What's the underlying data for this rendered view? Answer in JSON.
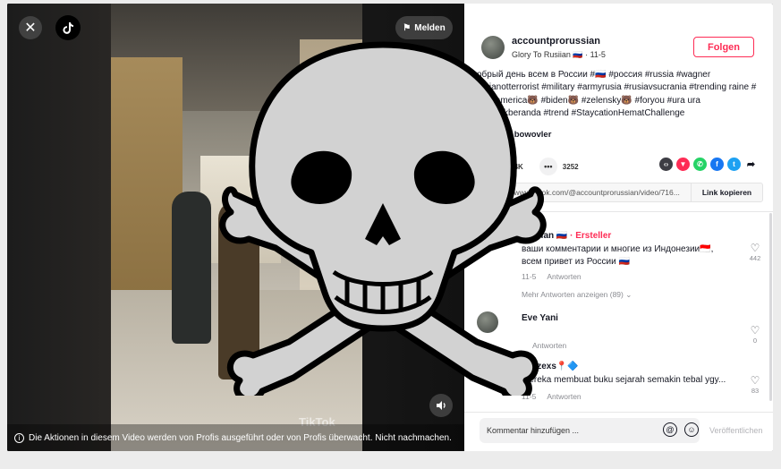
{
  "video": {
    "close_icon": "close-icon",
    "report_label": "Melden",
    "watermark": "TikTok",
    "warning": "Die Aktionen in diesem Video werden von Profis ausgeführt oder von Profis überwacht. Nicht nachmachen."
  },
  "post": {
    "username": "accountprorussian",
    "subline": "Glory To Rusiian 🇷🇺 · 11-5",
    "follow_label": "Folgen",
    "description": "обрый день всем в России #🇷🇺 #россия #russia #wagner rusianotterrorist #military #armyrusia #rusiavsucrania #trending raine #🇺🇦 #america🐻 #biden🐻 #zelensky🐻 #foryou #ura ura #masukberanda #trend #StaycationHematChallenge",
    "music": "ura asli - bowovler",
    "likes": "169.4K",
    "comments": "3252",
    "link": "https://www.tiktok.com/@accountprorussian/video/716...",
    "copy_label": "Link kopieren"
  },
  "comments": [
    {
      "name": "Rusiian 🇷🇺",
      "creator": "· Ersteller",
      "text": "ваши комментарии и многие из Индонезии🇮🇩, всем привет из России 🇷🇺",
      "date": "11-5",
      "reply": "Antworten",
      "likes": "442"
    },
    {
      "name": "Eve Yani",
      "creator": "",
      "text": "",
      "date": "",
      "reply": "Antworten",
      "likes": "0"
    },
    {
      "name": "me zexs📍🔷",
      "creator": "",
      "text": "mereka membuat buku sejarah semakin tebal ygy...",
      "date": "11-5",
      "reply": "Antworten",
      "likes": "83"
    }
  ],
  "more_replies": "Mehr Antworten anzeigen (89)",
  "composer": {
    "placeholder": "Kommentar hinzufügen ...",
    "post_label": "Veröffentlichen"
  },
  "colors": {
    "accent": "#fe2c55",
    "text": "#161823"
  }
}
